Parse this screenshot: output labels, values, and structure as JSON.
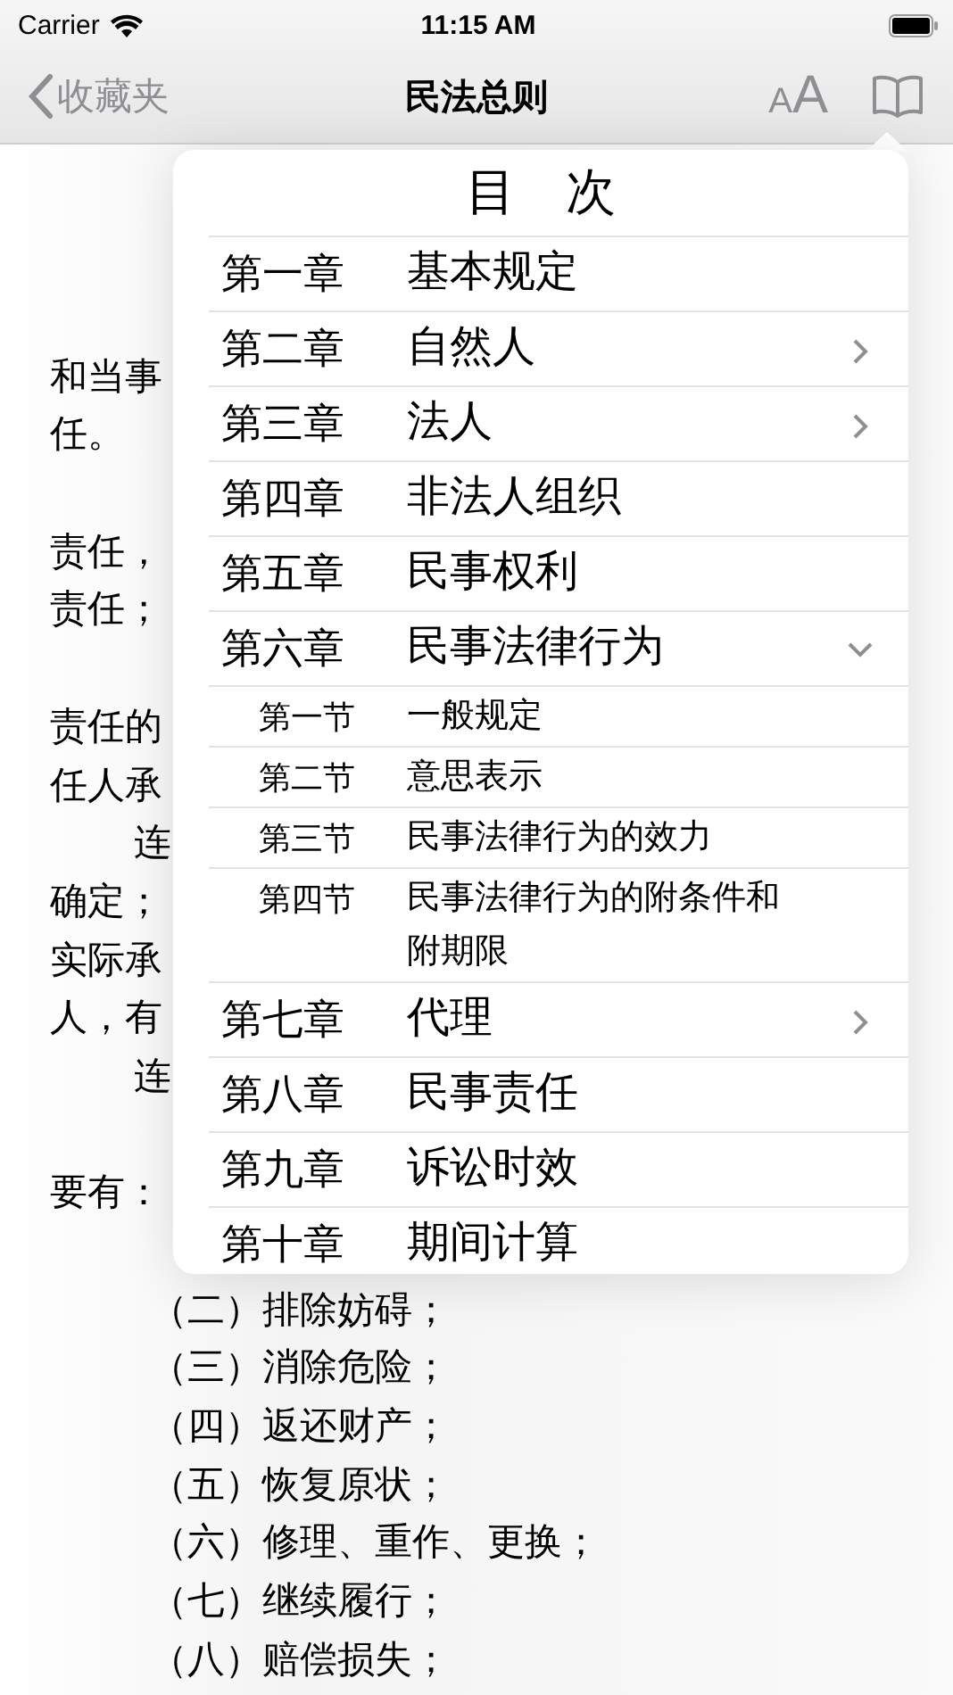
{
  "status_bar": {
    "carrier": "Carrier",
    "time": "11:15 AM"
  },
  "nav_bar": {
    "back_label": "收藏夹",
    "title": "民法总则",
    "font_size_small": "A",
    "font_size_large": "A"
  },
  "article": {
    "lines": [
      {
        "kind": "gap"
      },
      {
        "kind": "text",
        "text": "和当事"
      },
      {
        "kind": "text",
        "text": "任。"
      },
      {
        "kind": "gap"
      },
      {
        "kind": "text",
        "text": "责任，"
      },
      {
        "kind": "text",
        "text": "责任；"
      },
      {
        "kind": "gap"
      },
      {
        "kind": "text",
        "text": "责任的"
      },
      {
        "kind": "text",
        "text": "任人承"
      },
      {
        "kind": "indent",
        "text": "连"
      },
      {
        "kind": "text",
        "text": "确定；"
      },
      {
        "kind": "text",
        "text": "实际承"
      },
      {
        "kind": "text",
        "text": "人，有"
      },
      {
        "kind": "indent",
        "text": "连"
      },
      {
        "kind": "gap"
      },
      {
        "kind": "text",
        "text": "要有："
      },
      {
        "kind": "gap"
      },
      {
        "kind": "item",
        "text": "（二）排除妨碍；"
      },
      {
        "kind": "item",
        "text": "（三）消除危险；"
      },
      {
        "kind": "item",
        "text": "（四）返还财产；"
      },
      {
        "kind": "item",
        "text": "（五）恢复原状；"
      },
      {
        "kind": "item",
        "text": "（六）修理、重作、更换；"
      },
      {
        "kind": "item",
        "text": "（七）继续履行；"
      },
      {
        "kind": "item",
        "text": "（八）赔偿损失；"
      }
    ]
  },
  "contents": {
    "title": "目　次",
    "chapters": [
      {
        "number": "第一章",
        "title": "基本规定",
        "expandable": false
      },
      {
        "number": "第二章",
        "title": "自然人",
        "expandable": true,
        "expanded": false
      },
      {
        "number": "第三章",
        "title": "法人",
        "expandable": true,
        "expanded": false
      },
      {
        "number": "第四章",
        "title": "非法人组织",
        "expandable": false
      },
      {
        "number": "第五章",
        "title": "民事权利",
        "expandable": false
      },
      {
        "number": "第六章",
        "title": "民事法律行为",
        "expandable": true,
        "expanded": true,
        "children": [
          {
            "number": "第一节",
            "title": "一般规定"
          },
          {
            "number": "第二节",
            "title": "意思表示"
          },
          {
            "number": "第三节",
            "title": "民事法律行为的效力"
          },
          {
            "number": "第四节",
            "title": "民事法律行为的附条件和附期限"
          }
        ]
      },
      {
        "number": "第七章",
        "title": "代理",
        "expandable": true,
        "expanded": false
      },
      {
        "number": "第八章",
        "title": "民事责任",
        "expandable": false
      },
      {
        "number": "第九章",
        "title": "诉讼时效",
        "expandable": false
      },
      {
        "number": "第十章",
        "title": "期间计算",
        "expandable": false
      }
    ]
  }
}
